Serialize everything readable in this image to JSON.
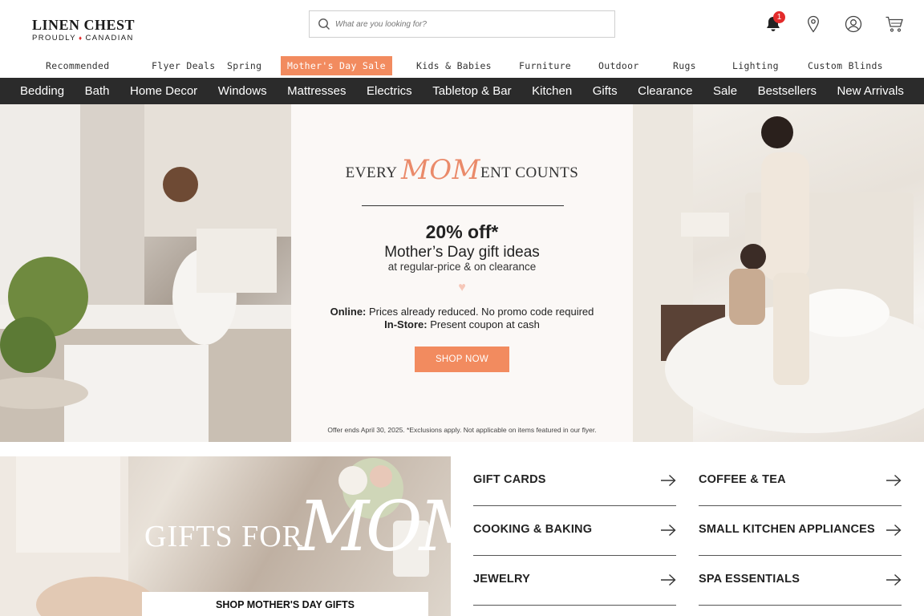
{
  "header": {
    "logo_main": "LINEN CHEST",
    "logo_sub_left": "PROUDLY",
    "logo_sub_right": "CANADIAN",
    "search_placeholder": "What are you looking for?",
    "notification_count": "1",
    "icons": [
      "bell-icon",
      "location-pin-icon",
      "account-icon",
      "cart-icon"
    ]
  },
  "topnav": [
    "Recommended",
    "Flyer Deals",
    "Spring",
    "Mother's Day Sale",
    "Kids & Babies",
    "Furniture",
    "Outdoor",
    "Rugs",
    "Lighting",
    "Custom Blinds"
  ],
  "mainnav": [
    "Bedding",
    "Bath",
    "Home Decor",
    "Windows",
    "Mattresses",
    "Electrics",
    "Tabletop & Bar",
    "Kitchen",
    "Gifts",
    "Clearance",
    "Sale",
    "Bestsellers",
    "New Arrivals"
  ],
  "hero": {
    "title_pre": "EVERY ",
    "title_mom": "MOM",
    "title_post": "ENT COUNTS",
    "discount": "20% off*",
    "subtitle": "Mother’s Day gift ideas",
    "subtitle2": "at regular-price & on clearance",
    "online_label": "Online:",
    "online_text": " Prices already reduced. No promo code required",
    "store_label": "In-Store:",
    "store_text": " Present coupon at cash",
    "cta": "SHOP NOW",
    "fineprint": "Offer ends April 30, 2025. *Exclusions apply. Not applicable on items featured in our flyer."
  },
  "gifts": {
    "text": "GIFTS FOR",
    "mom": "MOM",
    "cta": "SHOP MOTHER'S DAY GIFTS"
  },
  "categories": [
    "GIFT CARDS",
    "COFFEE & TEA",
    "COOKING & BAKING",
    "SMALL KITCHEN APPLIANCES",
    "JEWELRY",
    "SPA ESSENTIALS"
  ],
  "colors": {
    "accent": "#f28b5f",
    "nav_bg": "#2b2b2b",
    "badge": "#e32b2b"
  }
}
